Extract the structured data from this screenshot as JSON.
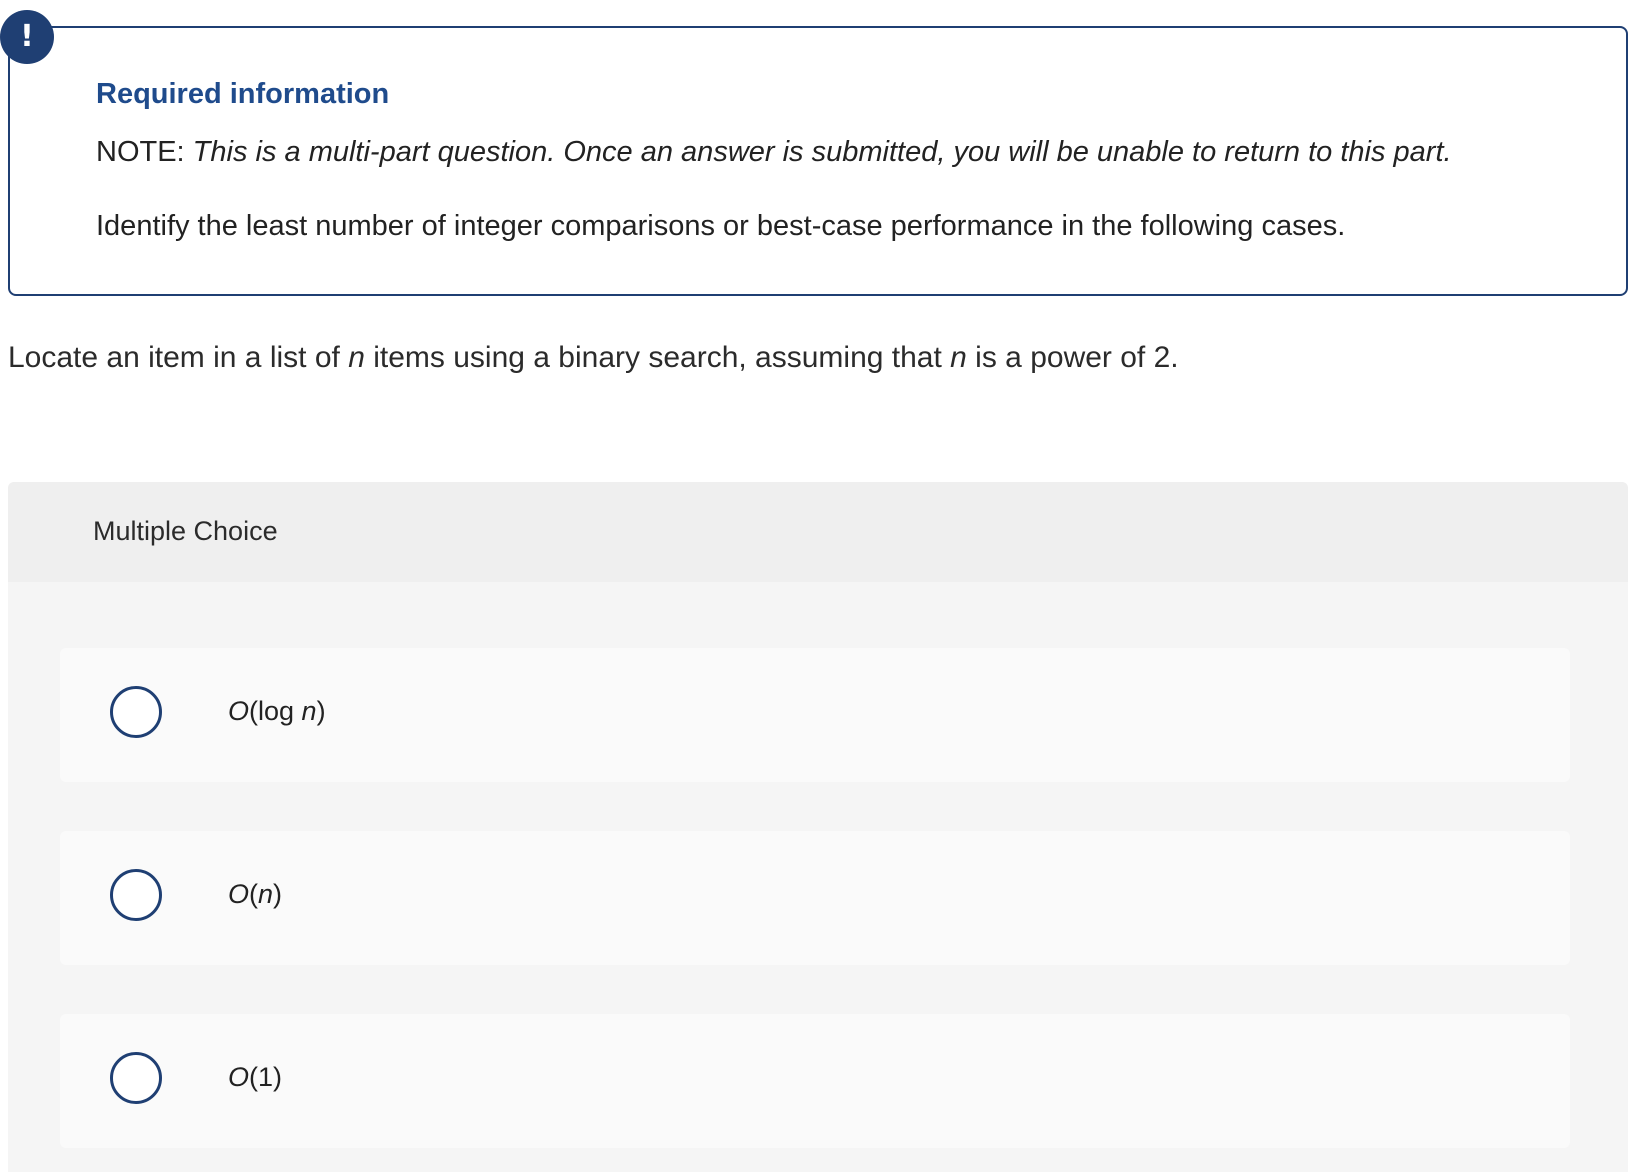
{
  "alert": {
    "badge_text": "!",
    "title": "Required information",
    "note_prefix": "NOTE: ",
    "note_italic": "This is a multi-part question. Once an answer is submitted, you will be unable to return to this part.",
    "instruction": "Identify the least number of integer comparisons or best-case performance in the following cases."
  },
  "question": {
    "part1": "Locate an item in a list of ",
    "var1": "n",
    "part2": " items using a binary search, assuming that ",
    "var2": "n",
    "part3": " is a power of 2."
  },
  "multiple_choice": {
    "header": "Multiple Choice",
    "options": [
      {
        "big_o": "O",
        "open": "(log ",
        "var": "n",
        "close": ")",
        "selected": false
      },
      {
        "big_o": "O",
        "open": "(",
        "var": "n",
        "close": ")",
        "selected": false
      },
      {
        "big_o": "O",
        "open": "(1)",
        "var": "",
        "close": "",
        "selected": false
      }
    ]
  },
  "colors": {
    "accent": "#1f3f73",
    "title_blue": "#1f4b8c",
    "panel_bg": "#f5f5f5",
    "header_bg": "#efefef",
    "option_bg": "#fafafa"
  }
}
